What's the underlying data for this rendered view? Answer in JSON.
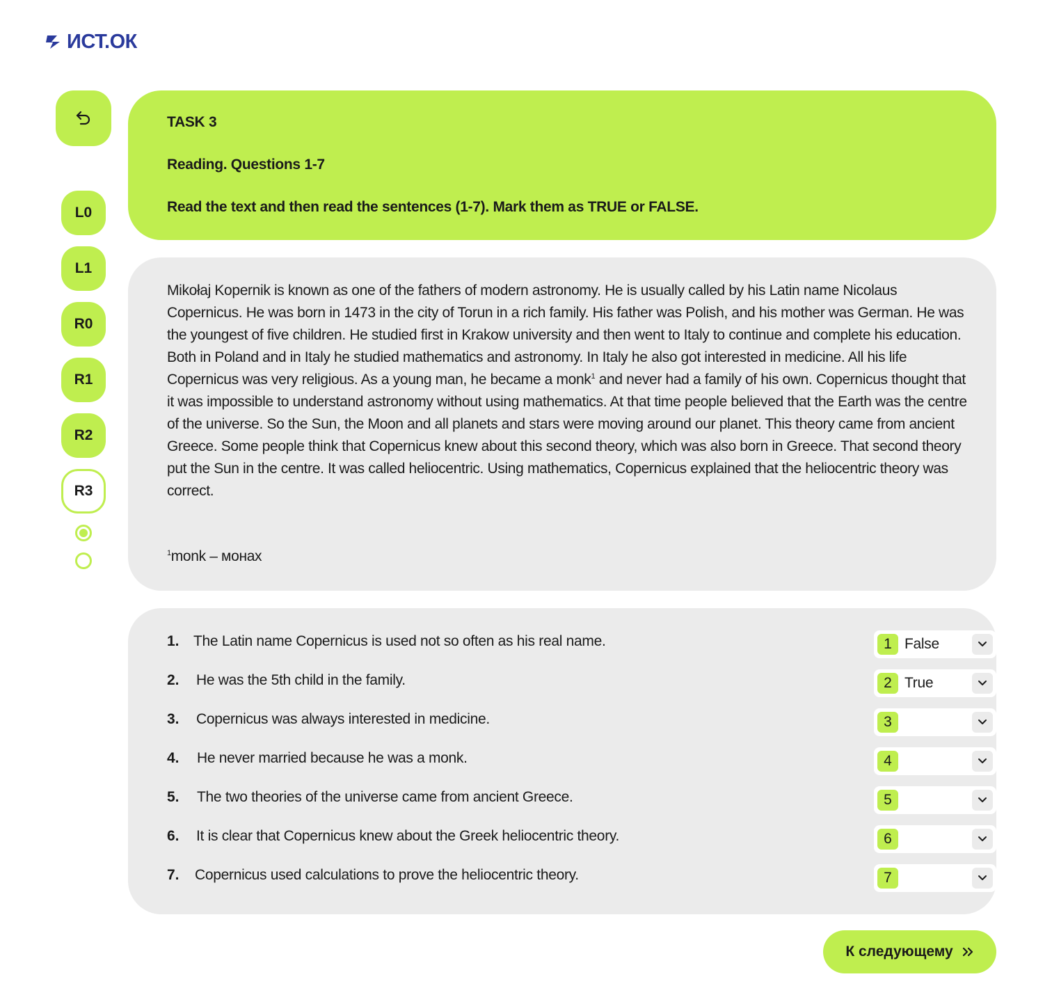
{
  "brand": {
    "logo_text": "ИСТ.ОК",
    "color": "#2a3a9c"
  },
  "colors": {
    "accent": "#bfee4f",
    "panel": "#ebebeb"
  },
  "sidebar": {
    "back_icon": "undo-arrow-icon",
    "items": [
      {
        "label": "L0",
        "active": false
      },
      {
        "label": "L1",
        "active": false
      },
      {
        "label": "R0",
        "active": false
      },
      {
        "label": "R1",
        "active": false
      },
      {
        "label": "R2",
        "active": false
      },
      {
        "label": "R3",
        "active": true
      }
    ],
    "steps": [
      {
        "filled": true
      },
      {
        "filled": false
      }
    ]
  },
  "task": {
    "title": "TASK 3",
    "subtitle": "Reading. Questions 1-7",
    "instruction_prefix": "Read the text and then read the sentences ",
    "instruction_range": "(1-7)",
    "instruction_mid": ". Mark them as ",
    "true_word": "TRUE",
    "or_word": " or ",
    "false_word": "FALSE",
    "instruction_end": "."
  },
  "passage": {
    "part1": "Mikołaj Kopernik is known as one of the fathers of modern astronomy. He is usually called by his Latin name Nicolaus Copernicus. He was born in 1473 in the city of Torun in a rich family. His father was Polish, and his mother was German. He was the youngest of five children. He studied first in Krakow university and then went to Italy to continue and complete his education. Both in Poland and in Italy he studied mathematics and astronomy. In Italy he also got interested in medicine. All his life Copernicus was very religious. As a young man, he became a monk",
    "footnote_mark": "1",
    "part2": " and never had a family of his own.   Copernicus thought that it was impossible to understand astronomy without using mathematics. At that time people believed that the Earth was the centre of the universe.  So the Sun, the Moon and all planets and stars were moving around our planet. This theory came from ancient Greece. Some people think that Copernicus knew about this second theory, which  was also  born in Greece. That second theory put the Sun in the centre. It was called heliocentric.  Using mathematics, Copernicus explained that the heliocentric theory was correct.",
    "footnote_text": "monk – монах"
  },
  "questions": [
    {
      "num": "1.",
      "text": "The Latin name Copernicus is used not so often as his real name.",
      "badge": "1",
      "answer": "False"
    },
    {
      "num": "2.",
      "text": "He was the 5th child in the family.",
      "badge": "2",
      "answer": "True"
    },
    {
      "num": "3.",
      "text": "Copernicus was always interested in medicine.",
      "badge": "3",
      "answer": ""
    },
    {
      "num": "4.",
      "text": "He never married because he was a monk.",
      "badge": "4",
      "answer": ""
    },
    {
      "num": "5.",
      "text": "The two theories of the universe came from ancient Greece.",
      "badge": "5",
      "answer": ""
    },
    {
      "num": "6.",
      "text": "It is clear that Copernicus knew about the Greek heliocentric theory.",
      "badge": "6",
      "answer": ""
    },
    {
      "num": "7.",
      "text": "Copernicus used calculations to prove the heliocentric theory.",
      "badge": "7",
      "answer": ""
    }
  ],
  "next_button": {
    "label": "К следующему",
    "icon": "double-chevron-right-icon"
  }
}
